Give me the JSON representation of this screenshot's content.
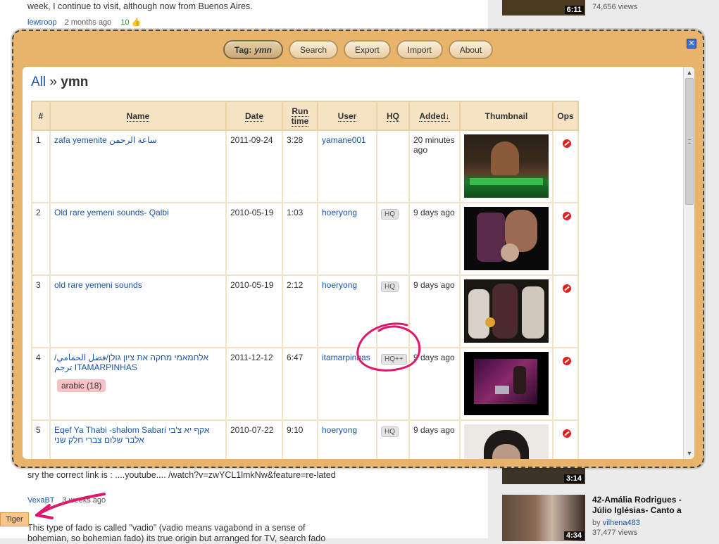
{
  "background": {
    "comment1_text": "week, I continue to visit, although now from Buenos Aires.",
    "comment1_user": "lewtroop",
    "comment1_time": "2 months ago",
    "comment1_likes": "10",
    "comment2_text": "sry the correct link is : ....youtube.... /watch?v=zwYCL1lmkNw&feature=re-lated",
    "comment2_user": "VexaBT",
    "comment2_time": "3 weeks ago",
    "comment3_text": "This type of fado is called \"vadio\" (vadio means vagabond in a sense of bohemian, so bohemian fado) its true origin but arranged for TV, search fado",
    "tiger_tag": "Tiger",
    "side": [
      {
        "duration": "6:11",
        "views": "74,656 views"
      },
      {
        "duration": "3:14"
      },
      {
        "duration": "4:34",
        "title": "42-Amália Rodrigues - Júlio Iglésias- Canto a",
        "by_prefix": "by",
        "by_user": "vilhena483",
        "views": "37,477 views"
      }
    ]
  },
  "modal": {
    "toolbar": {
      "tag_label": "Tag:",
      "tag_value": "ymn",
      "search": "Search",
      "export": "Export",
      "import": "Import",
      "about": "About"
    },
    "close_glyph": "✕",
    "breadcrumb": {
      "all": "All",
      "sep": "»",
      "current": "ymn"
    },
    "columns": [
      "#",
      "Name",
      "Date",
      "Run time",
      "User",
      "HQ",
      "Added↓",
      "Thumbnail",
      "Ops"
    ],
    "rows": [
      {
        "num": "1",
        "name": "zafa yemenite ساعة الرحمن",
        "date": "2011-09-24",
        "runtime": "3:28",
        "user": "yamane001",
        "hq": "",
        "added": "20 minutes ago",
        "tag": ""
      },
      {
        "num": "2",
        "name": "Old rare yemeni sounds- Qalbi",
        "date": "2010-05-19",
        "runtime": "1:03",
        "user": "hoeryong",
        "hq": "HQ",
        "added": "9 days ago",
        "tag": ""
      },
      {
        "num": "3",
        "name": "old rare yemeni sounds",
        "date": "2010-05-19",
        "runtime": "2:12",
        "user": "hoeryong",
        "hq": "HQ",
        "added": "9 days ago",
        "tag": ""
      },
      {
        "num": "4",
        "name": "אלחמאמי מחקה את ציון גולן/فضل الحمامي/ ترجم ITAMARPINHAS",
        "date": "2011-12-12",
        "runtime": "6:47",
        "user": "itamarpinhas",
        "hq": "HQ++",
        "added": "9 days ago",
        "tag": "arabic (18)"
      },
      {
        "num": "5",
        "name": "Eqef Ya Thabi -shalom Sabari אקף יא צ'בי אלבר שלום צברי חלק שני",
        "date": "2010-07-22",
        "runtime": "9:10",
        "user": "hoeryong",
        "hq": "HQ",
        "added": "9 days ago",
        "tag": ""
      }
    ],
    "colors": {
      "accent": "#e8b46b",
      "header_bg": "#f5e3c4",
      "link": "#1a55a8",
      "delete": "#e41e1e"
    }
  }
}
